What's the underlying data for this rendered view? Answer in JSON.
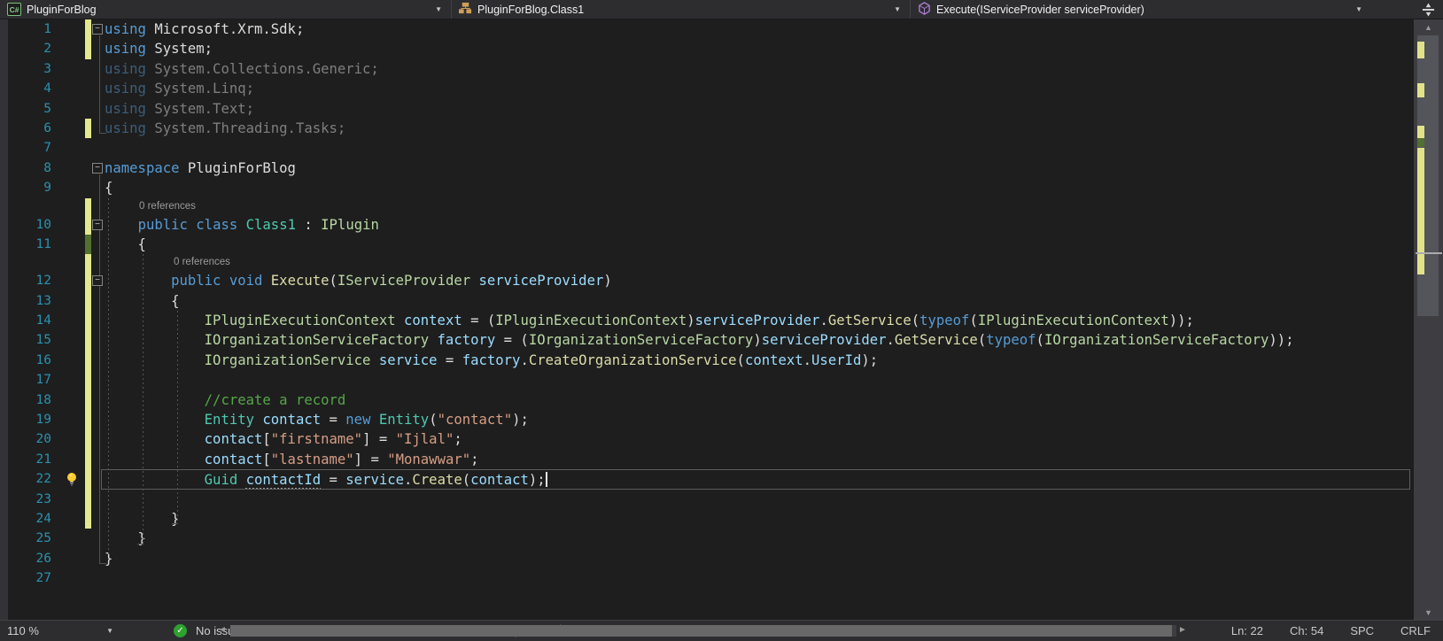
{
  "colors": {
    "editor_bg": "#1E1E1E",
    "navbar_bg": "#2D2D30",
    "keyword": "#569CD6",
    "class_type": "#4EC9B0",
    "interface_type": "#B8D7A3",
    "method": "#DCDCAA",
    "identifier": "#9CDCFE",
    "string": "#D69D85",
    "comment": "#57A64A",
    "line_number": "#2B91AF",
    "changed_unsaved": "#E3E78E",
    "changed_saved": "#52702E",
    "status_ok": "#2EA12E"
  },
  "navbar": {
    "project": {
      "label": "PluginForBlog",
      "icon": "csharp-project-icon",
      "icon_text": "C#"
    },
    "type": {
      "label": "PluginForBlog.Class1",
      "icon": "class-icon"
    },
    "member": {
      "label": "Execute(IServiceProvider serviceProvider)",
      "icon": "method-icon"
    }
  },
  "editor": {
    "rows": [
      {
        "type": "code",
        "n": 1,
        "gutter": "y",
        "fold": true,
        "segs": [
          [
            "kw",
            "using"
          ],
          [
            "def",
            " Microsoft.Xrm.Sdk;"
          ]
        ]
      },
      {
        "type": "code",
        "n": 2,
        "gutter": "y",
        "segs": [
          [
            "kw",
            "using"
          ],
          [
            "def",
            " System;"
          ]
        ]
      },
      {
        "type": "code",
        "n": 3,
        "dim": true,
        "segs": [
          [
            "kw",
            "using"
          ],
          [
            "def",
            " System.Collections.Generic;"
          ]
        ]
      },
      {
        "type": "code",
        "n": 4,
        "dim": true,
        "segs": [
          [
            "kw",
            "using"
          ],
          [
            "def",
            " System.Linq;"
          ]
        ]
      },
      {
        "type": "code",
        "n": 5,
        "dim": true,
        "segs": [
          [
            "kw",
            "using"
          ],
          [
            "def",
            " System.Text;"
          ]
        ]
      },
      {
        "type": "code",
        "n": 6,
        "gutter": "y",
        "dim": true,
        "segs": [
          [
            "kw",
            "using"
          ],
          [
            "def",
            " System.Threading.Tasks;"
          ]
        ]
      },
      {
        "type": "code",
        "n": 7,
        "segs": []
      },
      {
        "type": "code",
        "n": 8,
        "fold": true,
        "segs": [
          [
            "kw",
            "namespace"
          ],
          [
            "def",
            " PluginForBlog"
          ]
        ]
      },
      {
        "type": "code",
        "n": 9,
        "segs": [
          [
            "def",
            "{"
          ]
        ]
      },
      {
        "type": "lens",
        "gutter": "y",
        "text": "0 references",
        "pad": 39
      },
      {
        "type": "code",
        "n": 10,
        "gutter": "y",
        "fold": true,
        "segs": [
          [
            "def",
            "    "
          ],
          [
            "kw",
            "public"
          ],
          [
            "def",
            " "
          ],
          [
            "kw",
            "class"
          ],
          [
            "def",
            " "
          ],
          [
            "typ",
            "Class1"
          ],
          [
            "def",
            " : "
          ],
          [
            "int",
            "IPlugin"
          ]
        ]
      },
      {
        "type": "code",
        "n": 11,
        "gutter": "g",
        "segs": [
          [
            "def",
            "    {"
          ]
        ]
      },
      {
        "type": "lens",
        "gutter": "y",
        "text": "0 references",
        "pad": 78
      },
      {
        "type": "code",
        "n": 12,
        "gutter": "y",
        "fold": true,
        "segs": [
          [
            "def",
            "        "
          ],
          [
            "kw",
            "public"
          ],
          [
            "def",
            " "
          ],
          [
            "kw",
            "void"
          ],
          [
            "def",
            " "
          ],
          [
            "met",
            "Execute"
          ],
          [
            "def",
            "("
          ],
          [
            "int",
            "IServiceProvider"
          ],
          [
            "def",
            " "
          ],
          [
            "loc",
            "serviceProvider"
          ],
          [
            "def",
            ")"
          ]
        ]
      },
      {
        "type": "code",
        "n": 13,
        "gutter": "y",
        "segs": [
          [
            "def",
            "        {"
          ]
        ]
      },
      {
        "type": "code",
        "n": 14,
        "gutter": "y",
        "segs": [
          [
            "def",
            "            "
          ],
          [
            "int",
            "IPluginExecutionContext"
          ],
          [
            "def",
            " "
          ],
          [
            "loc",
            "context"
          ],
          [
            "def",
            " = ("
          ],
          [
            "int",
            "IPluginExecutionContext"
          ],
          [
            "def",
            ")"
          ],
          [
            "loc",
            "serviceProvider"
          ],
          [
            "def",
            "."
          ],
          [
            "met",
            "GetService"
          ],
          [
            "def",
            "("
          ],
          [
            "kw",
            "typeof"
          ],
          [
            "def",
            "("
          ],
          [
            "int",
            "IPluginExecutionContext"
          ],
          [
            "def",
            "));"
          ]
        ]
      },
      {
        "type": "code",
        "n": 15,
        "gutter": "y",
        "segs": [
          [
            "def",
            "            "
          ],
          [
            "int",
            "IOrganizationServiceFactory"
          ],
          [
            "def",
            " "
          ],
          [
            "loc",
            "factory"
          ],
          [
            "def",
            " = ("
          ],
          [
            "int",
            "IOrganizationServiceFactory"
          ],
          [
            "def",
            ")"
          ],
          [
            "loc",
            "serviceProvider"
          ],
          [
            "def",
            "."
          ],
          [
            "met",
            "GetService"
          ],
          [
            "def",
            "("
          ],
          [
            "kw",
            "typeof"
          ],
          [
            "def",
            "("
          ],
          [
            "int",
            "IOrganizationServiceFactory"
          ],
          [
            "def",
            "));"
          ]
        ]
      },
      {
        "type": "code",
        "n": 16,
        "gutter": "y",
        "segs": [
          [
            "def",
            "            "
          ],
          [
            "int",
            "IOrganizationService"
          ],
          [
            "def",
            " "
          ],
          [
            "loc",
            "service"
          ],
          [
            "def",
            " = "
          ],
          [
            "loc",
            "factory"
          ],
          [
            "def",
            "."
          ],
          [
            "met",
            "CreateOrganizationService"
          ],
          [
            "def",
            "("
          ],
          [
            "loc",
            "context"
          ],
          [
            "def",
            "."
          ],
          [
            "loc",
            "UserId"
          ],
          [
            "def",
            ");"
          ]
        ]
      },
      {
        "type": "code",
        "n": 17,
        "gutter": "y",
        "segs": []
      },
      {
        "type": "code",
        "n": 18,
        "gutter": "y",
        "segs": [
          [
            "def",
            "            "
          ],
          [
            "com",
            "//create a record"
          ]
        ]
      },
      {
        "type": "code",
        "n": 19,
        "gutter": "y",
        "segs": [
          [
            "def",
            "            "
          ],
          [
            "typ",
            "Entity"
          ],
          [
            "def",
            " "
          ],
          [
            "loc",
            "contact"
          ],
          [
            "def",
            " = "
          ],
          [
            "kw",
            "new"
          ],
          [
            "def",
            " "
          ],
          [
            "typ",
            "Entity"
          ],
          [
            "def",
            "("
          ],
          [
            "str",
            "\"contact\""
          ],
          [
            "def",
            ");"
          ]
        ]
      },
      {
        "type": "code",
        "n": 20,
        "gutter": "y",
        "segs": [
          [
            "def",
            "            "
          ],
          [
            "loc",
            "contact"
          ],
          [
            "def",
            "["
          ],
          [
            "str",
            "\"firstname\""
          ],
          [
            "def",
            "] = "
          ],
          [
            "str",
            "\"Ijlal\""
          ],
          [
            "def",
            ";"
          ]
        ]
      },
      {
        "type": "code",
        "n": 21,
        "gutter": "y",
        "segs": [
          [
            "def",
            "            "
          ],
          [
            "loc",
            "contact"
          ],
          [
            "def",
            "["
          ],
          [
            "str",
            "\"lastname\""
          ],
          [
            "def",
            "] = "
          ],
          [
            "str",
            "\"Monawwar\""
          ],
          [
            "def",
            ";"
          ]
        ]
      },
      {
        "type": "code",
        "n": 22,
        "gutter": "y",
        "current": true,
        "bulb": true,
        "cursor": true,
        "segs": [
          [
            "def",
            "            "
          ],
          [
            "typ",
            "Guid"
          ],
          [
            "def",
            " "
          ],
          [
            "locu",
            "contactId"
          ],
          [
            "def",
            " = "
          ],
          [
            "loc",
            "service"
          ],
          [
            "def",
            "."
          ],
          [
            "met",
            "Create"
          ],
          [
            "def",
            "("
          ],
          [
            "loc",
            "contact"
          ],
          [
            "def",
            ");"
          ]
        ]
      },
      {
        "type": "code",
        "n": 23,
        "gutter": "y",
        "segs": []
      },
      {
        "type": "code",
        "n": 24,
        "gutter": "y",
        "segs": [
          [
            "def",
            "        }"
          ]
        ]
      },
      {
        "type": "code",
        "n": 25,
        "segs": [
          [
            "def",
            "    }"
          ]
        ]
      },
      {
        "type": "code",
        "n": 26,
        "segs": [
          [
            "def",
            "}"
          ]
        ]
      },
      {
        "type": "code",
        "n": 27,
        "segs": []
      }
    ]
  },
  "statusbar": {
    "zoom": "110 %",
    "health": "No issues found",
    "separator": "|",
    "line": "Ln: 22",
    "column": "Ch: 54",
    "whitespace": "SPC",
    "line_ending": "CRLF"
  },
  "icons": {
    "up_arrow": "▲",
    "down_arrow": "▼",
    "left_arrow": "◄",
    "right_arrow": "►",
    "dropdown_arrow": "▼",
    "check": "✓",
    "fold_collapse": "−"
  }
}
